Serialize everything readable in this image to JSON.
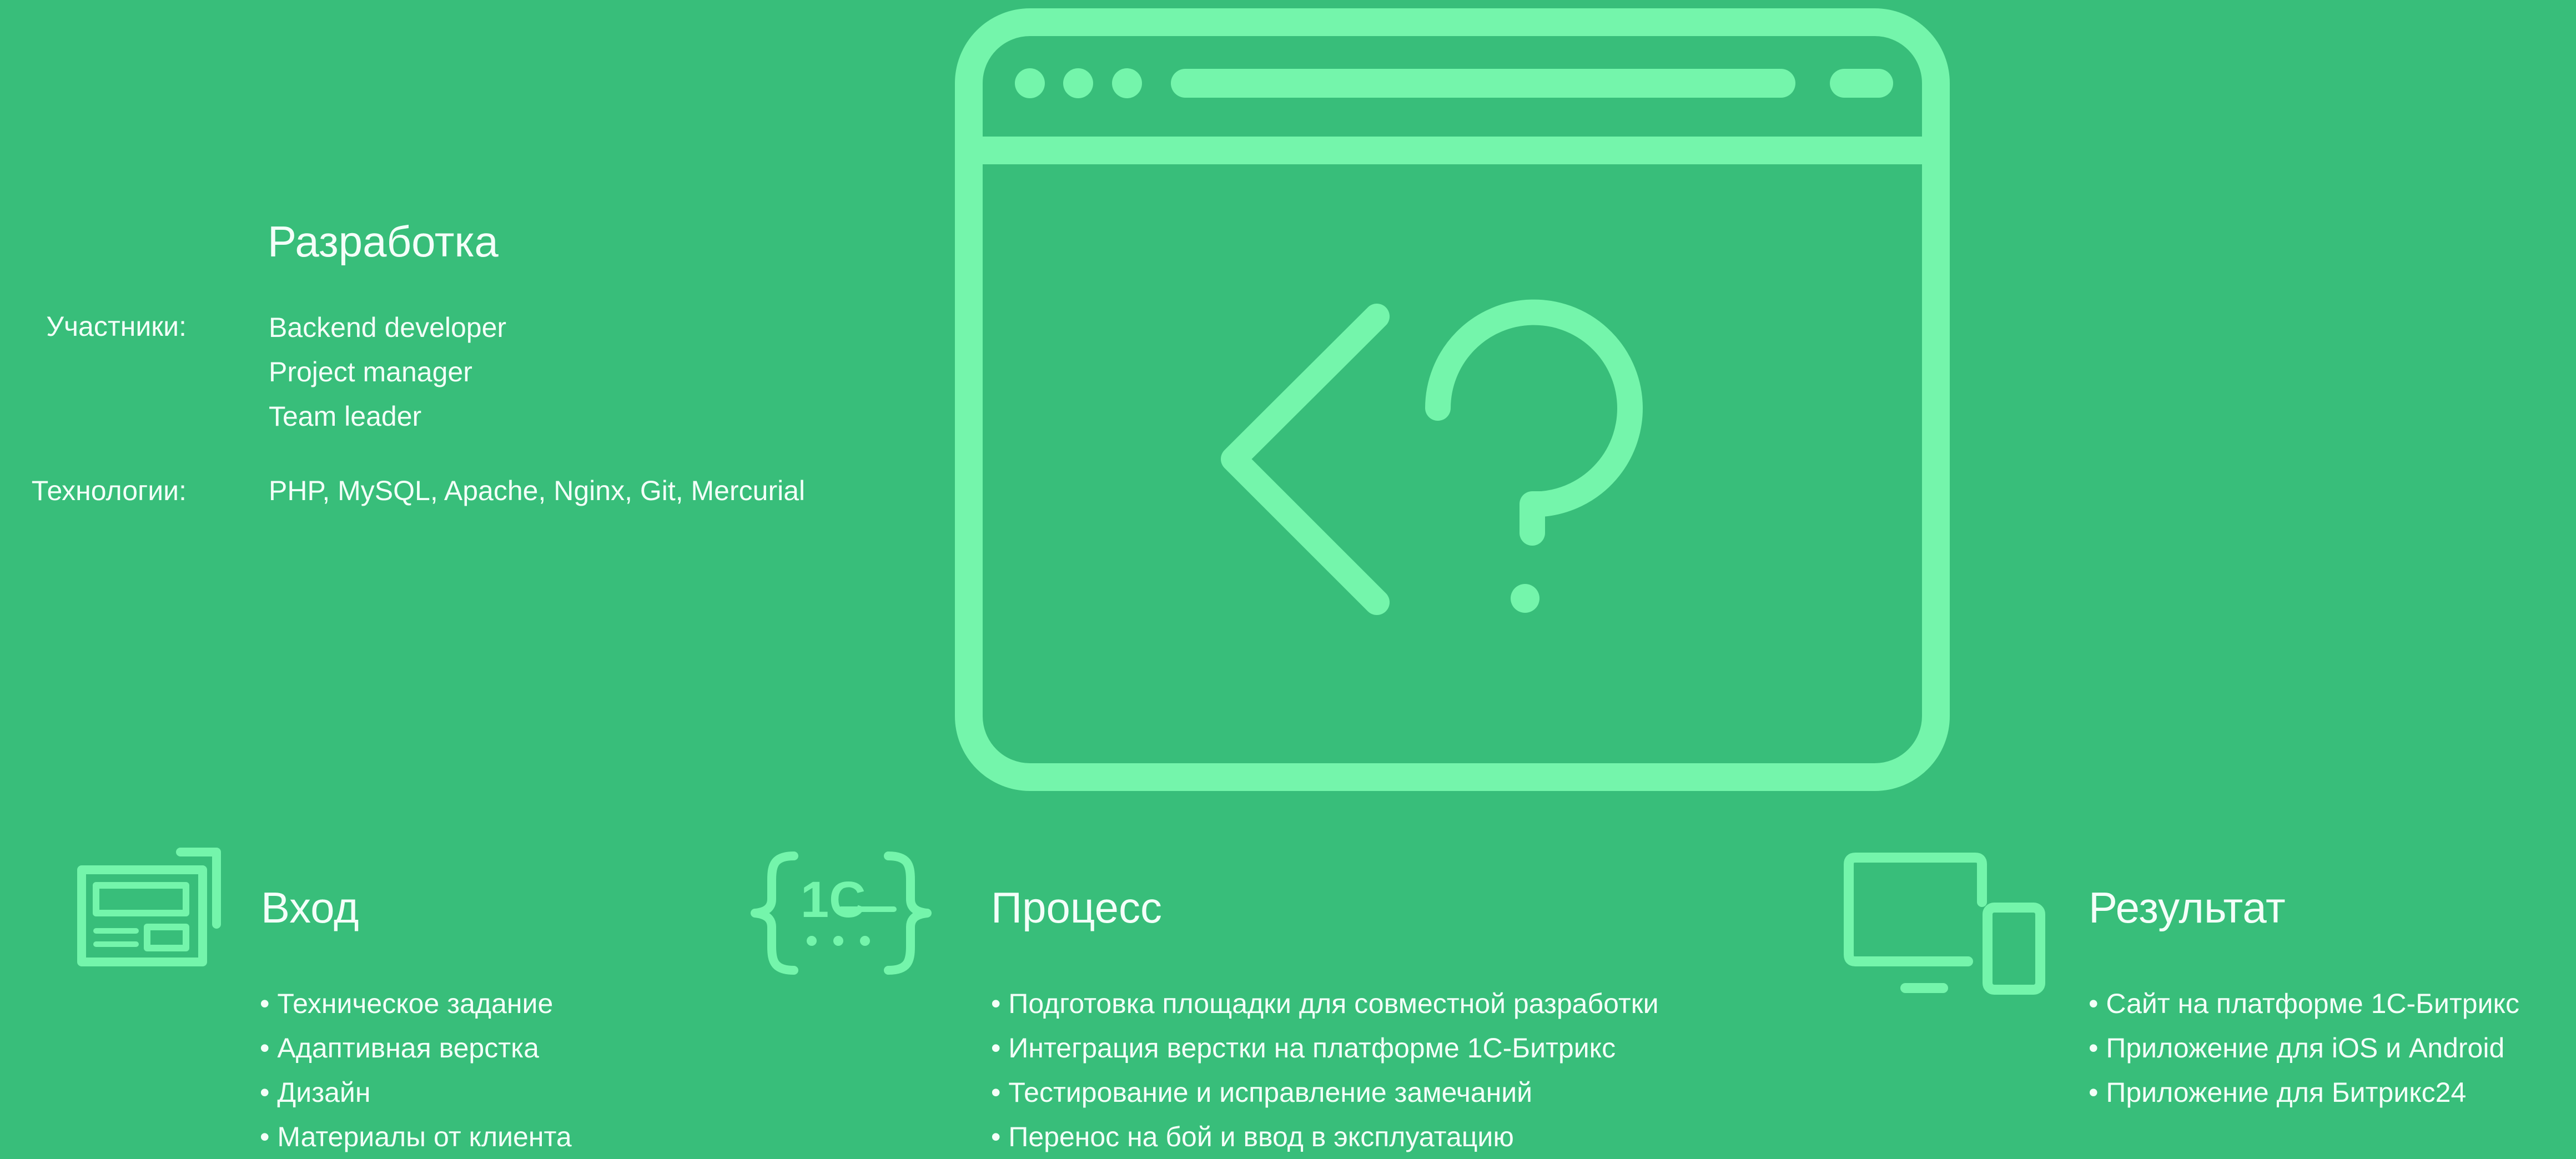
{
  "development": {
    "title": "Разработка",
    "participants_label": "Участники:",
    "participants": [
      "Backend developer",
      "Project manager",
      "Team leader"
    ],
    "technologies_label": "Технологии:",
    "technologies": "PHP, MySQL, Apache, Nginx, Git, Mercurial"
  },
  "input": {
    "title": "Вход",
    "items": [
      "• Техническое задание",
      "• Адаптивная верстка",
      "• Дизайн",
      "• Материалы от клиента"
    ]
  },
  "process": {
    "title": "Процесс",
    "items": [
      "• Подготовка площадки для совместной разработки",
      "• Интеграция верстки на платформе 1С-Битрикс",
      "• Тестирование и исправление замечаний",
      "• Перенос на бой и ввод в эксплуатацию"
    ]
  },
  "result": {
    "title": "Результат",
    "items": [
      "• Сайт на платформе 1С-Битрикс",
      "• Приложение для iOS и Android",
      "• Приложение для Битрикс24"
    ]
  },
  "colors": {
    "background": "#38be7a",
    "accent": "#74f5ab",
    "text": "#f3fff8"
  },
  "icons": {
    "hero": "browser-code-question-icon",
    "input": "document-layout-icon",
    "process": "1c-code-icon",
    "result": "desktop-and-phone-icon"
  },
  "logo_text": "1C"
}
